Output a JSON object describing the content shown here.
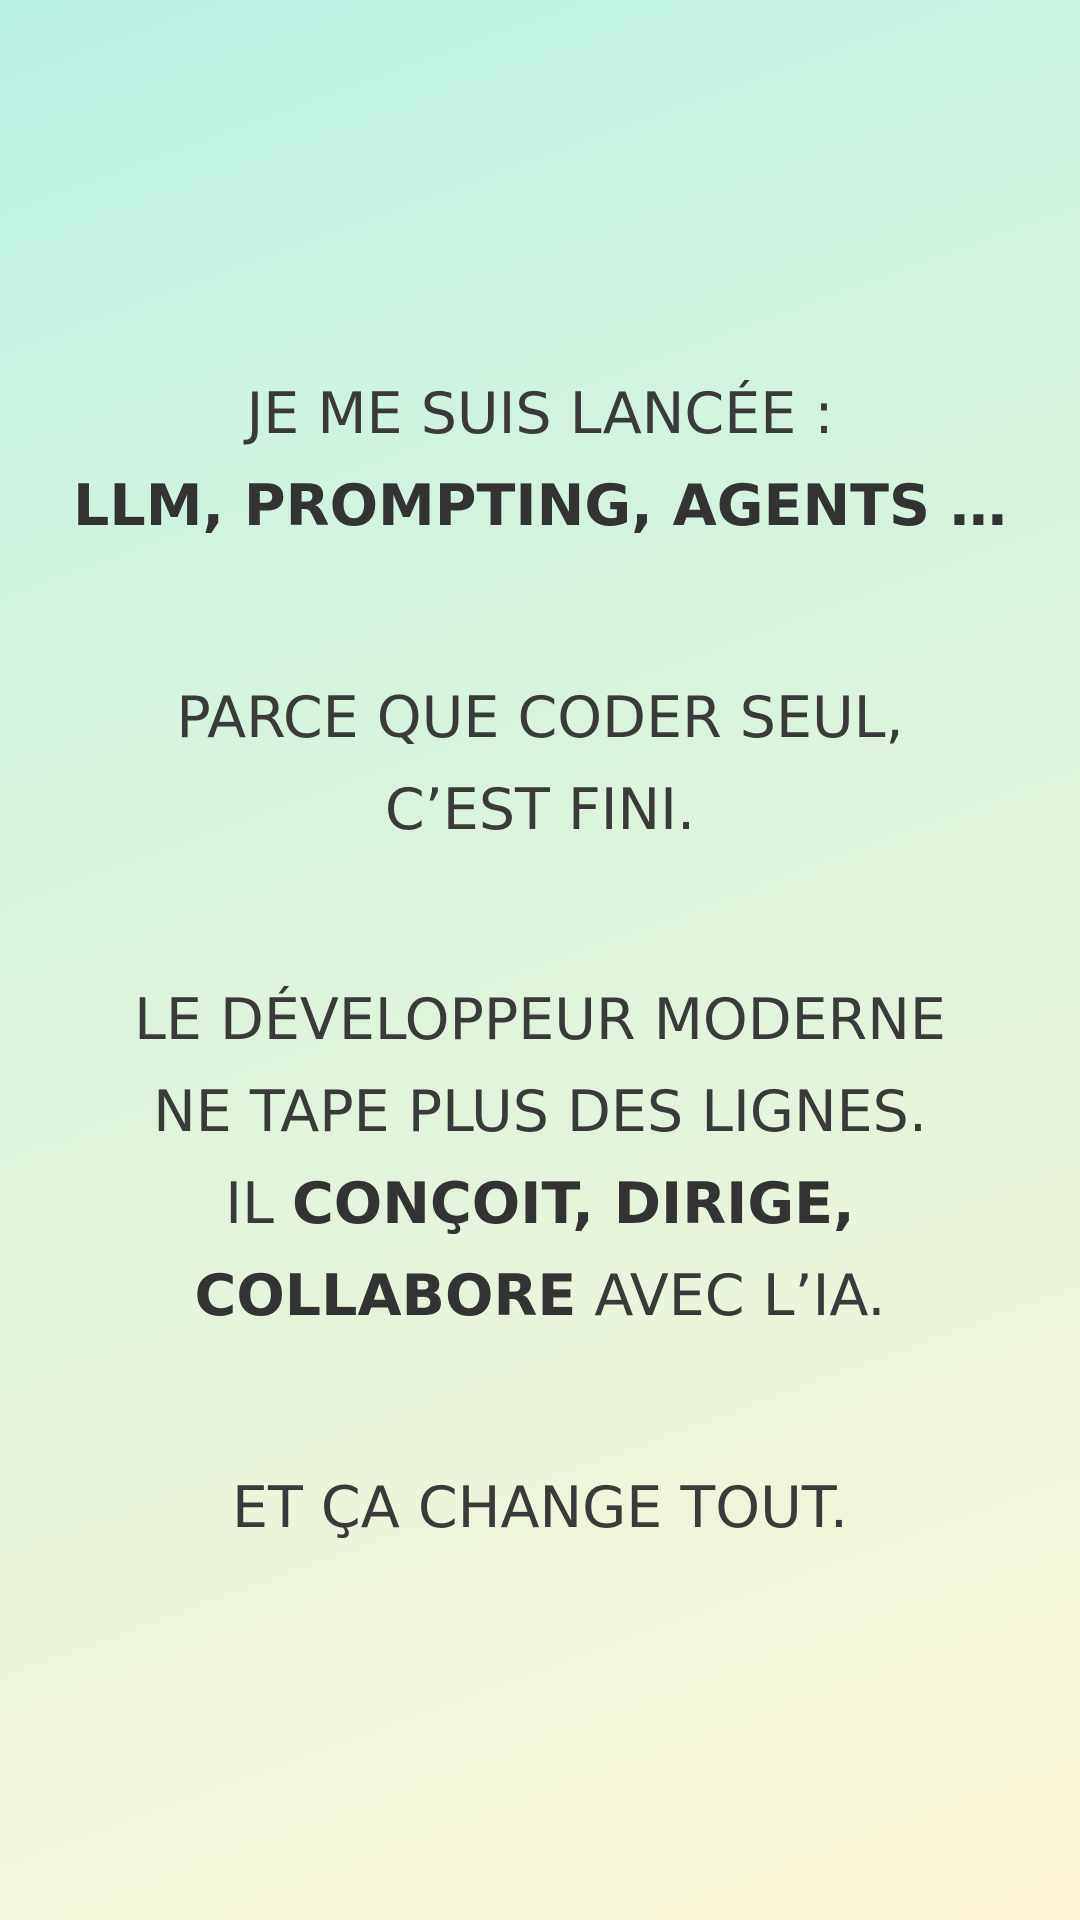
{
  "block_1": {
    "line_1": "JE ME SUIS LANCÉE :",
    "line_2": "LLM, PROMPTING, AGENTS …"
  },
  "block_2": {
    "line_1": "PARCE QUE CODER SEUL,",
    "line_2": "C’EST FINI."
  },
  "block_3": {
    "line_1": "LE DÉVELOPPEUR MODERNE",
    "line_2": "NE TAPE PLUS DES LIGNES.",
    "line_3_prefix": "IL ",
    "line_3_bold": "CONÇOIT, DIRIGE,",
    "line_4_bold": "COLLABORE",
    "line_4_suffix": " AVEC L’IA."
  },
  "block_4": {
    "line_1": "ET ÇA CHANGE TOUT."
  },
  "colors": {
    "text": "#333333",
    "gradient_top": "#b6f1e4",
    "gradient_bottom": "#fdf6d6"
  }
}
